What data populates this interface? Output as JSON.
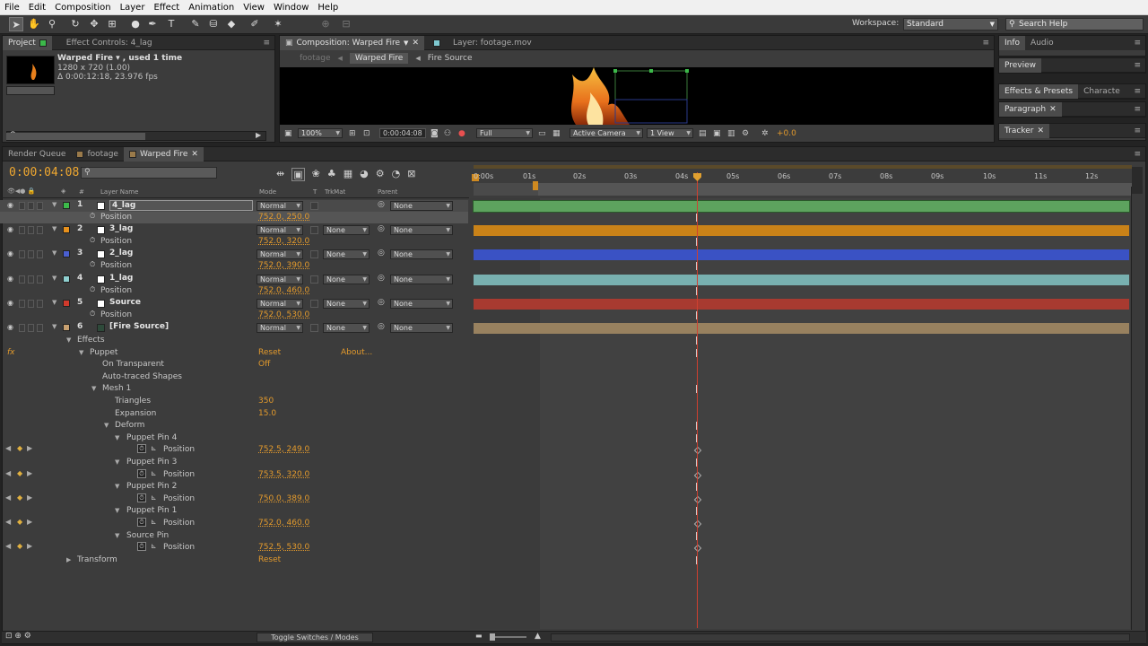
{
  "menu": [
    "File",
    "Edit",
    "Composition",
    "Layer",
    "Effect",
    "Animation",
    "View",
    "Window",
    "Help"
  ],
  "workspace": {
    "label": "Workspace:",
    "value": "Standard",
    "search_placeholder": "Search Help"
  },
  "project": {
    "tabs": [
      "Project",
      "Effect Controls: 4_lag"
    ],
    "item_name": "Warped Fire ▾ , used 1 time",
    "item_size": "1280 x 720 (1.00)",
    "item_duration": "Δ 0:00:12:18, 23.976 fps"
  },
  "comp": {
    "tabs": [
      "Composition: Warped Fire",
      "Layer: footage.mov"
    ],
    "breadcrumbs": [
      "footage",
      "Warped Fire",
      "Fire Source"
    ],
    "zoom": "100%",
    "timecode": "0:00:04:08",
    "resolution": "Full",
    "camera": "Active Camera",
    "views": "1 View",
    "exposure": "+0.0"
  },
  "right_panels": {
    "info_tabs": [
      "Info",
      "Audio"
    ],
    "preview": "Preview",
    "effects_tabs": [
      "Effects & Presets",
      "Characte"
    ],
    "paragraph": "Paragraph",
    "tracker": "Tracker"
  },
  "timeline": {
    "tabs": [
      "Render Queue",
      "footage",
      "Warped Fire"
    ],
    "timecode": "0:00:04:08",
    "headers": {
      "layer_name": "Layer Name",
      "mode": "Mode",
      "t": "T",
      "trkmat": "TrkMat",
      "parent": "Parent"
    },
    "ruler": [
      "0:00s",
      "01s",
      "02s",
      "03s",
      "04s",
      "05s",
      "06s",
      "07s",
      "08s",
      "09s",
      "10s",
      "11s",
      "12s"
    ],
    "layers": [
      {
        "num": "1",
        "name": "4_lag",
        "mode": "Normal",
        "trkmat": "",
        "parent": "None",
        "color": "#3cb94a",
        "bar": "#5da35e",
        "position": "752.0, 250.0"
      },
      {
        "num": "2",
        "name": "3_lag",
        "mode": "Normal",
        "trkmat": "None",
        "parent": "None",
        "color": "#e8911c",
        "bar": "#c98218",
        "position": "752.0, 320.0"
      },
      {
        "num": "3",
        "name": "2_lag",
        "mode": "Normal",
        "trkmat": "None",
        "parent": "None",
        "color": "#4a5fd0",
        "bar": "#3a52c4",
        "position": "752.0, 390.0"
      },
      {
        "num": "4",
        "name": "1_lag",
        "mode": "Normal",
        "trkmat": "None",
        "parent": "None",
        "color": "#8fd0d0",
        "bar": "#78b0b0",
        "position": "752.0, 460.0"
      },
      {
        "num": "5",
        "name": "Source",
        "mode": "Normal",
        "trkmat": "None",
        "parent": "None",
        "color": "#d03a2c",
        "bar": "#a83a30",
        "position": "752.0, 530.0"
      },
      {
        "num": "6",
        "name": "[Fire Source]",
        "mode": "Normal",
        "trkmat": "None",
        "parent": "None",
        "color": "#c8a070",
        "bar": "#98815f",
        "position": ""
      }
    ],
    "position_label": "Position",
    "effects": {
      "effects_label": "Effects",
      "fx": "fx",
      "puppet": "Puppet",
      "reset": "Reset",
      "about": "About...",
      "on_transparent": "On Transparent",
      "on_transparent_value": "Off",
      "auto_traced": "Auto-traced Shapes",
      "mesh": "Mesh 1",
      "triangles": "Triangles",
      "triangles_value": "350",
      "expansion": "Expansion",
      "expansion_value": "15.0",
      "deform": "Deform",
      "pins": [
        {
          "name": "Puppet Pin 4",
          "position": "752.5, 249.0"
        },
        {
          "name": "Puppet Pin 3",
          "position": "753.5, 320.0"
        },
        {
          "name": "Puppet Pin 2",
          "position": "750.0, 389.0"
        },
        {
          "name": "Puppet Pin 1",
          "position": "752.0, 460.0"
        },
        {
          "name": "Source Pin",
          "position": "752.5, 530.0"
        }
      ],
      "transform": "Transform",
      "transform_reset": "Reset"
    },
    "toggle": "Toggle Switches / Modes"
  }
}
